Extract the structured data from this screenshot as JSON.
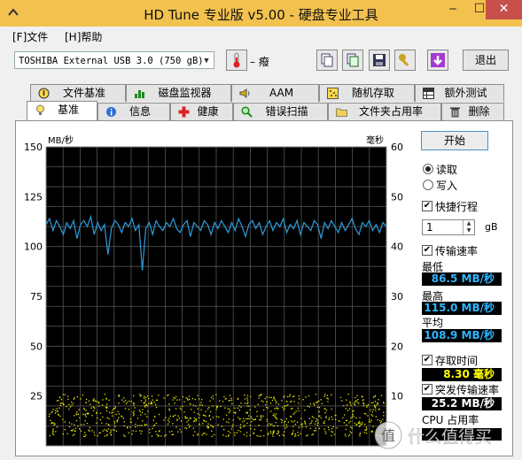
{
  "window": {
    "title": "HD Tune 专业版 v5.00 - 硬盘专业工具",
    "min_icon": "minimize-icon",
    "max_icon": "maximize-icon",
    "close_icon": "close-icon"
  },
  "menu": [
    {
      "label": "[F]文件"
    },
    {
      "label": "[H]帮助"
    }
  ],
  "toolbar": {
    "drive": "TOSHIBA External USB 3.0 (750 gB)",
    "temperature": "– 癈",
    "exit_label": "退出",
    "icons": [
      "thermometer-icon",
      "copy-icon",
      "copy-text-icon",
      "save-icon",
      "wrench-icon",
      "download-icon"
    ]
  },
  "tabs_row1": [
    {
      "label": "文件基准",
      "icon": "info-pin-icon"
    },
    {
      "label": "磁盘监视器",
      "icon": "bar-chart-icon"
    },
    {
      "label": "AAM",
      "icon": "speaker-icon"
    },
    {
      "label": "随机存取",
      "icon": "scatter-icon"
    },
    {
      "label": "额外测试",
      "icon": "table-icon"
    }
  ],
  "tabs_row2": [
    {
      "label": "基准",
      "icon": "bulb-icon",
      "active": true
    },
    {
      "label": "信息",
      "icon": "info-icon"
    },
    {
      "label": "健康",
      "icon": "plus-cross-icon"
    },
    {
      "label": "错误扫描",
      "icon": "magnifier-icon"
    },
    {
      "label": "文件夹占用率",
      "icon": "folder-icon"
    },
    {
      "label": "删除",
      "icon": "trash-icon"
    }
  ],
  "controls": {
    "start_label": "开始",
    "read_label": "读取",
    "write_label": "写入",
    "read_selected": true,
    "quick_label": "快捷行程",
    "quick_checked": true,
    "quick_value": "1",
    "quick_unit": "gB",
    "transfer_label": "传输速率",
    "transfer_checked": true,
    "min_label": "最低",
    "min_value": "86.5 MB/秒",
    "max_label": "最高",
    "max_value": "115.0 MB/秒",
    "avg_label": "平均",
    "avg_value": "108.9 MB/秒",
    "access_label": "存取时间",
    "access_checked": true,
    "access_value": "8.30 毫秒",
    "burst_label": "突发传输速率",
    "burst_checked": true,
    "burst_value": "25.2 MB/秒",
    "cpu_label": "CPU 占用率"
  },
  "watermark": {
    "text": "值 什么值得买"
  },
  "chart_data": {
    "type": "line",
    "ylabel_left": "MB/秒",
    "ylabel_right": "毫秒",
    "ylim_left": [
      0,
      150
    ],
    "ylim_right": [
      0,
      60
    ],
    "yticks_left": [
      150,
      125,
      100,
      75,
      50,
      25
    ],
    "yticks_right": [
      60,
      50,
      40,
      30,
      20,
      10
    ],
    "grid": true,
    "background": "#000000",
    "series": [
      {
        "name": "传输速率",
        "color": "#2e9bdc",
        "axis": "left",
        "values": [
          111,
          114,
          108,
          113,
          110,
          106,
          112,
          109,
          113,
          104,
          111,
          113,
          110,
          115,
          106,
          112,
          108,
          111,
          96,
          109,
          113,
          111,
          107,
          112,
          110,
          114,
          108,
          111,
          88,
          109,
          112,
          106,
          113,
          110,
          108,
          112,
          110,
          114,
          109,
          107,
          111,
          113,
          105,
          112,
          110,
          108,
          113,
          111,
          106,
          112,
          109,
          113,
          110,
          107,
          112,
          108,
          114,
          110,
          105,
          111,
          113,
          109,
          112,
          106,
          110,
          113,
          108,
          112,
          110,
          114,
          107,
          111,
          109,
          113,
          106,
          112,
          110,
          108,
          113,
          111,
          104,
          112,
          109,
          113,
          110,
          107,
          112,
          108,
          111,
          114,
          109,
          106,
          112,
          110,
          113,
          108,
          111,
          107,
          112,
          110
        ]
      },
      {
        "name": "存取时间",
        "color": "#e8e800",
        "axis": "right",
        "type": "scatter",
        "y_range": [
          2,
          10.5
        ],
        "point_count": 900
      }
    ]
  }
}
